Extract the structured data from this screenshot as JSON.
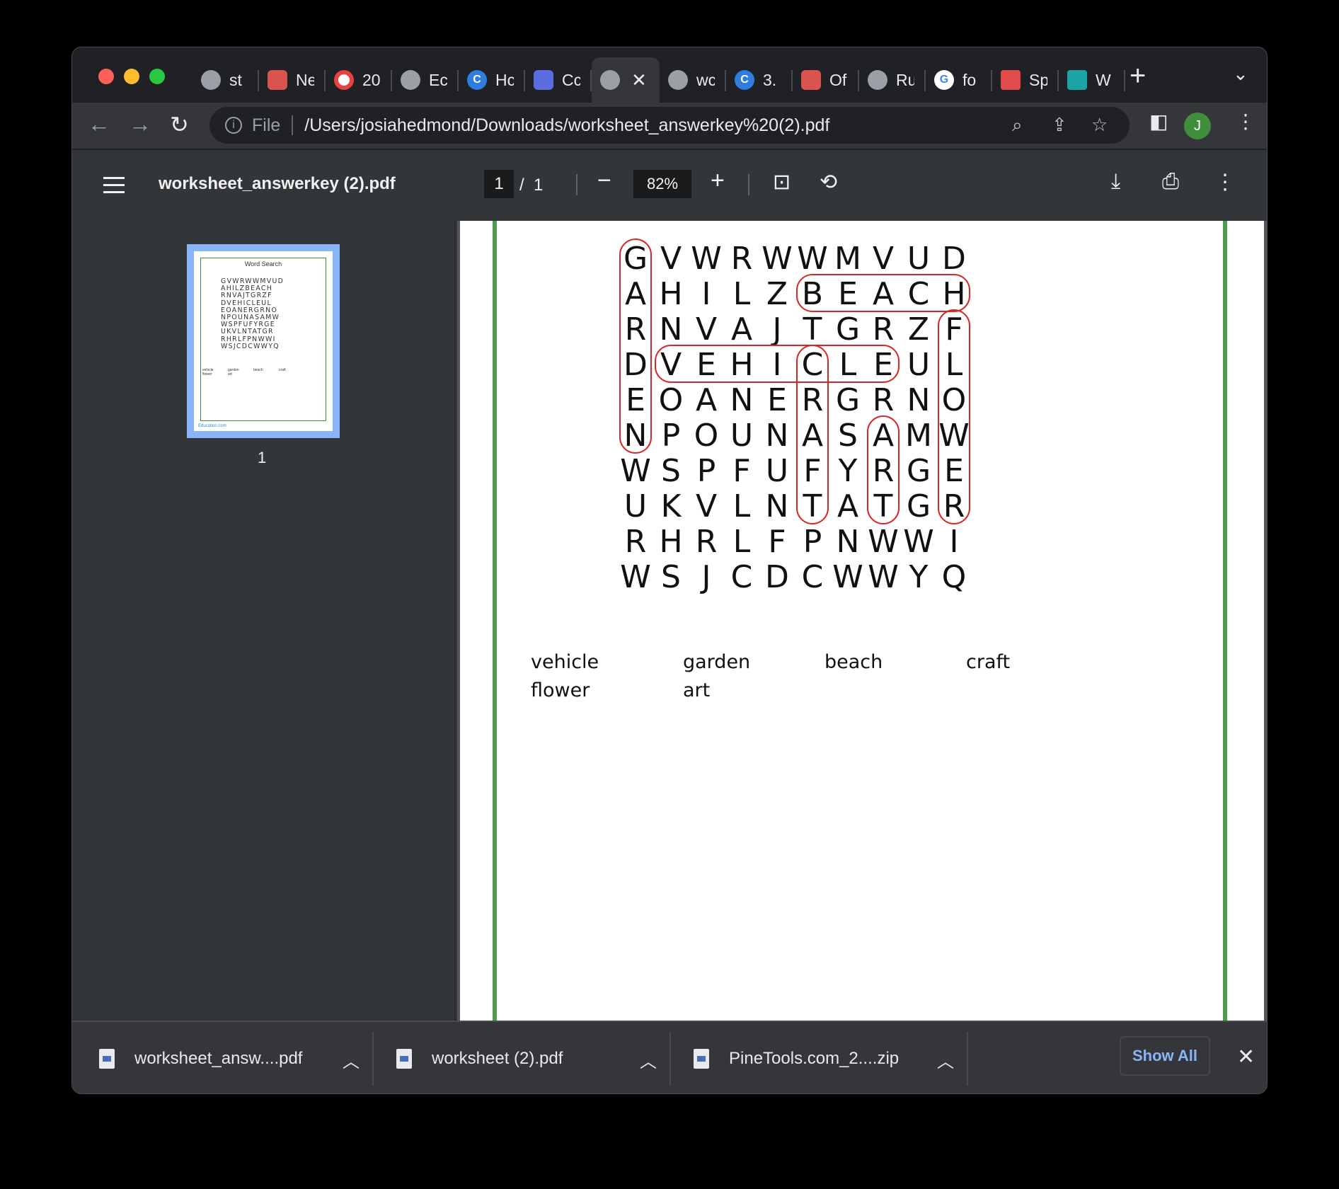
{
  "tabs": [
    {
      "label": "st",
      "icon": "globe-icon"
    },
    {
      "label": "Ne",
      "icon": "crest-icon"
    },
    {
      "label": "20",
      "icon": "target-icon"
    },
    {
      "label": "Ec",
      "icon": "globe-icon"
    },
    {
      "label": "Hc",
      "icon": "canva-icon"
    },
    {
      "label": "Cc",
      "icon": "document-icon"
    },
    {
      "label": "",
      "icon": "globe-icon",
      "active": true
    },
    {
      "label": "wc",
      "icon": "globe-icon"
    },
    {
      "label": "3.",
      "icon": "canva-icon"
    },
    {
      "label": "Of",
      "icon": "crest-icon"
    },
    {
      "label": "Ru",
      "icon": "globe-icon"
    },
    {
      "label": "fo",
      "icon": "google-icon"
    },
    {
      "label": "Sp",
      "icon": "tree-icon"
    },
    {
      "label": "W",
      "icon": "leaf-icon"
    }
  ],
  "address": {
    "scheme": "File",
    "url": "/Users/josiahedmond/Downloads/worksheet_answerkey%20(2).pdf"
  },
  "profile_initial": "J",
  "pdf": {
    "title": "worksheet_answerkey (2).pdf",
    "current_page": "1",
    "page_separator": "/",
    "total_pages": "1",
    "zoom": "82%"
  },
  "thumbnail": {
    "page_label": "1",
    "title": "Word Search",
    "logo": "Education.com"
  },
  "worksheet": {
    "grid": [
      "GVWRWWMVUD",
      "AHILZBEACH",
      "RNVAJTGRZF",
      "DVEHICLEUL",
      "EOANERGRNO",
      "NPOUNASAMW",
      "WSPFUFYRGE",
      "UKVLNTATGR",
      "RHRLFPNWWI",
      "WSJCDCWWYQ"
    ],
    "words": [
      "vehicle",
      "garden",
      "beach",
      "craft",
      "flower",
      "art"
    ]
  },
  "downloads": [
    {
      "name": "worksheet_answ....pdf"
    },
    {
      "name": "worksheet (2).pdf"
    },
    {
      "name": "PineTools.com_2....zip"
    }
  ],
  "show_all_label": "Show All",
  "colors": {
    "circle": "#d62828",
    "frame": "#4e9a4e",
    "accent": "#8ab4f8"
  }
}
